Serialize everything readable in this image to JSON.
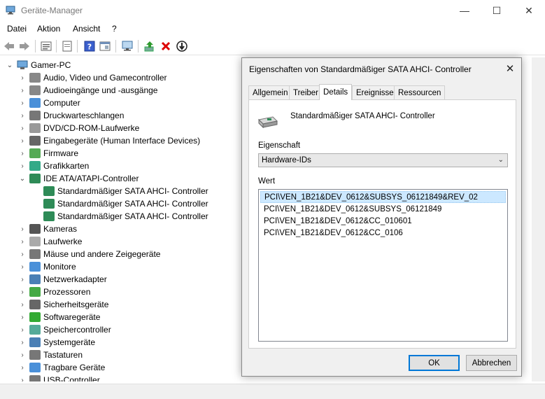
{
  "window": {
    "title": "Geräte-Manager",
    "buttons": {
      "minimize": "—",
      "maximize": "☐",
      "close": "✕"
    }
  },
  "menu": [
    "Datei",
    "Aktion",
    "Ansicht",
    "?"
  ],
  "tree": {
    "root": "Gamer-PC",
    "items": [
      {
        "label": "Audio, Video und Gamecontroller",
        "icon": "speaker-icon",
        "expanded": false
      },
      {
        "label": "Audioeingänge und -ausgänge",
        "icon": "speaker-icon",
        "expanded": false
      },
      {
        "label": "Computer",
        "icon": "monitor-icon",
        "expanded": false
      },
      {
        "label": "Druckwarteschlangen",
        "icon": "printer-icon",
        "expanded": false
      },
      {
        "label": "DVD/CD-ROM-Laufwerke",
        "icon": "disc-drive-icon",
        "expanded": false
      },
      {
        "label": "Eingabegeräte (Human Interface Devices)",
        "icon": "hid-icon",
        "expanded": false
      },
      {
        "label": "Firmware",
        "icon": "chip-icon",
        "expanded": false
      },
      {
        "label": "Grafikkarten",
        "icon": "display-adapter-icon",
        "expanded": false
      },
      {
        "label": "IDE ATA/ATAPI-Controller",
        "icon": "controller-icon",
        "expanded": true,
        "children": [
          "Standardmäßiger SATA AHCI- Controller",
          "Standardmäßiger SATA AHCI- Controller",
          "Standardmäßiger SATA AHCI- Controller"
        ]
      },
      {
        "label": "Kameras",
        "icon": "camera-icon",
        "expanded": false
      },
      {
        "label": "Laufwerke",
        "icon": "drive-icon",
        "expanded": false
      },
      {
        "label": "Mäuse und andere Zeigegeräte",
        "icon": "mouse-icon",
        "expanded": false
      },
      {
        "label": "Monitore",
        "icon": "monitor-icon",
        "expanded": false
      },
      {
        "label": "Netzwerkadapter",
        "icon": "network-icon",
        "expanded": false
      },
      {
        "label": "Prozessoren",
        "icon": "cpu-icon",
        "expanded": false
      },
      {
        "label": "Sicherheitsgeräte",
        "icon": "security-icon",
        "expanded": false
      },
      {
        "label": "Softwaregeräte",
        "icon": "software-icon",
        "expanded": false
      },
      {
        "label": "Speichercontroller",
        "icon": "storage-icon",
        "expanded": false
      },
      {
        "label": "Systemgeräte",
        "icon": "system-icon",
        "expanded": false
      },
      {
        "label": "Tastaturen",
        "icon": "keyboard-icon",
        "expanded": false
      },
      {
        "label": "Tragbare Geräte",
        "icon": "portable-icon",
        "expanded": false
      },
      {
        "label": "USB-Controller",
        "icon": "usb-icon",
        "expanded": false
      }
    ]
  },
  "dialog": {
    "title": "Eigenschaften von Standardmäßiger SATA AHCI- Controller",
    "close": "✕",
    "tabs": [
      "Allgemein",
      "Treiber",
      "Details",
      "Ereignisse",
      "Ressourcen"
    ],
    "active_tab": "Details",
    "device_name": "Standardmäßiger SATA AHCI- Controller",
    "property_label": "Eigenschaft",
    "property_value": "Hardware-IDs",
    "value_label": "Wert",
    "values": [
      "PCI\\VEN_1B21&DEV_0612&SUBSYS_06121849&REV_02",
      "PCI\\VEN_1B21&DEV_0612&SUBSYS_06121849",
      "PCI\\VEN_1B21&DEV_0612&CC_010601",
      "PCI\\VEN_1B21&DEV_0612&CC_0106"
    ],
    "ok_label": "OK",
    "cancel_label": "Abbrechen"
  }
}
